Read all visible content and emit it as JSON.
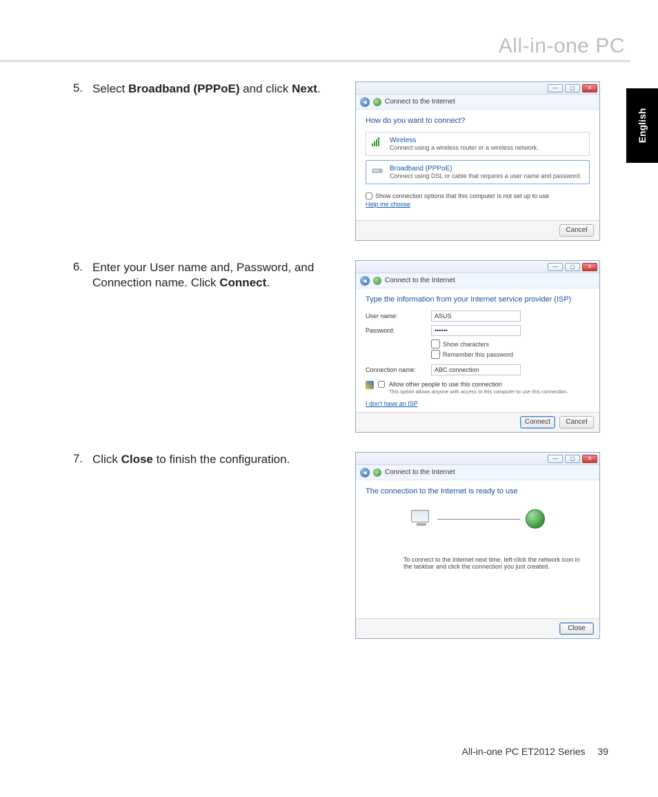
{
  "header": {
    "title": "All-in-one PC"
  },
  "langTab": "English",
  "steps": {
    "s5": {
      "num": "5.",
      "pre": "Select ",
      "bold1": "Broadband (PPPoE)",
      "mid": " and click ",
      "bold2": "Next",
      "post": "."
    },
    "s6": {
      "num": "6.",
      "pre": "Enter your User name and, Password, and Connection name. Click ",
      "bold1": "Connect",
      "post": "."
    },
    "s7": {
      "num": "7.",
      "pre": "Click ",
      "bold1": "Close",
      "post": " to finish the configuration."
    }
  },
  "dlg": {
    "title": "Connect to the Internet",
    "s5": {
      "prompt": "How do you want to connect?",
      "opt1": {
        "title": "Wireless",
        "desc": "Connect using a wireless router or a wireless network."
      },
      "opt2": {
        "title": "Broadband (PPPoE)",
        "desc": "Connect using DSL or cable that requires a user name and password."
      },
      "showOpt": "Show connection options that this computer is not set up to use",
      "help": "Help me choose",
      "cancel": "Cancel"
    },
    "s6": {
      "prompt": "Type the information from your Internet service provider (ISP)",
      "userLabel": "User name:",
      "userVal": "ASUS",
      "passLabel": "Password:",
      "passVal": "••••••",
      "showChars": "Show characters",
      "remember": "Remember this password",
      "connLabel": "Connection name:",
      "connVal": "ABC connection",
      "allowTitle": "Allow other people to use this connection",
      "allowDesc": "This option allows anyone with access to this computer to use this connection.",
      "noIsp": "I don't have an ISP",
      "connect": "Connect",
      "cancel": "Cancel"
    },
    "s7": {
      "prompt": "The connection to the Internet is ready to use",
      "note": "To connect to the Internet next time, left-click the network icon in the taskbar and click the connection you just created.",
      "close": "Close"
    }
  },
  "footer": {
    "series": "All-in-one PC ET2012 Series",
    "page": "39"
  }
}
